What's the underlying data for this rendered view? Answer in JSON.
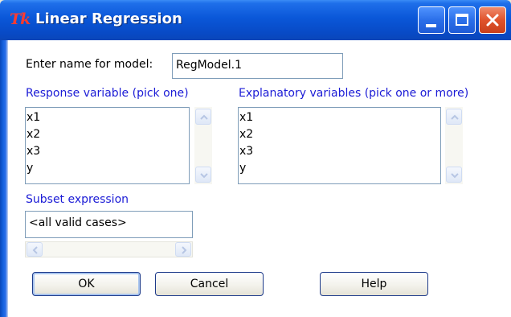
{
  "window": {
    "icon_text": "Tk",
    "title": "Linear Regression"
  },
  "model_name": {
    "label": "Enter name for model:",
    "value": "RegModel.1"
  },
  "response": {
    "label": "Response variable (pick one)",
    "items": [
      "x1",
      "x2",
      "x3",
      "y"
    ]
  },
  "explanatory": {
    "label": "Explanatory variables (pick one or more)",
    "items": [
      "x1",
      "x2",
      "x3",
      "y"
    ]
  },
  "subset": {
    "label": "Subset expression",
    "value": "<all valid cases>"
  },
  "buttons": {
    "ok": "OK",
    "cancel": "Cancel",
    "help": "Help"
  },
  "colors": {
    "title_bar": "#0a57d8",
    "label_blue": "#1b1bd6"
  }
}
